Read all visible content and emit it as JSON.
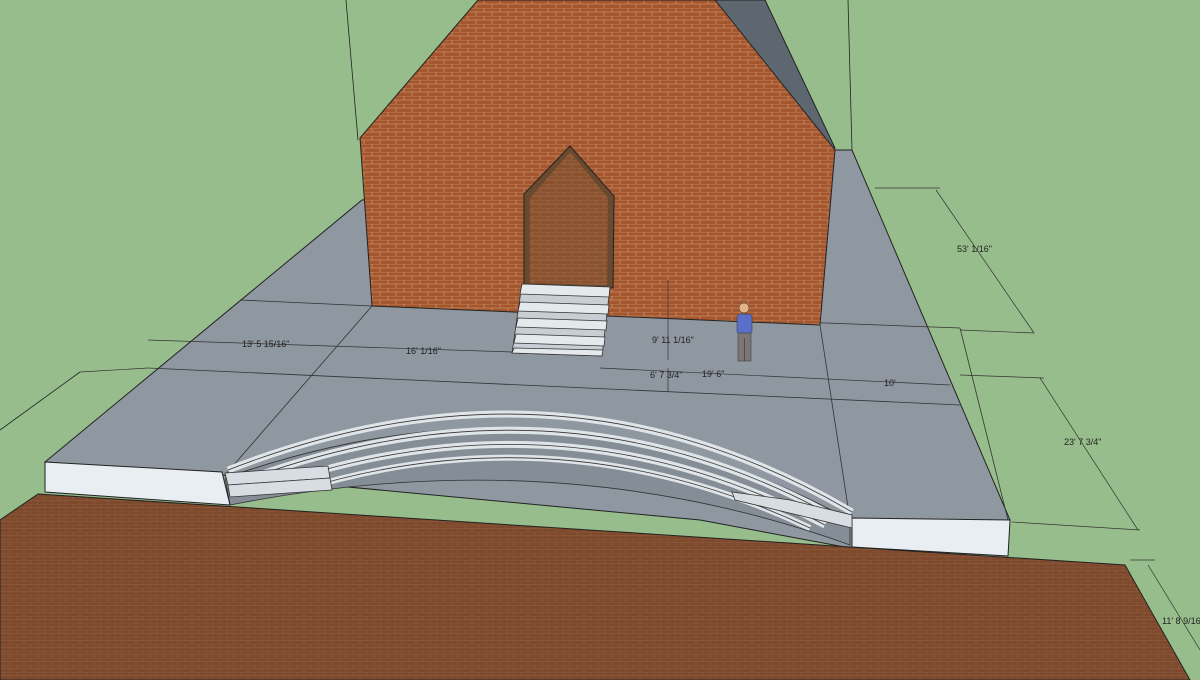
{
  "colors": {
    "ground": "#97bd8c",
    "plaza_top": "#8f97a1",
    "plaza_side": "#e8eef2",
    "brick": "#a4562f",
    "brick_mortar": "#c98a62",
    "brick_path": "#7d4a2e",
    "roof": "#5e6670",
    "step_light": "#d7dde2",
    "person_shirt": "#5a6fc9",
    "person_pants": "#7c7774"
  },
  "icons": [
    "person-figure-icon"
  ],
  "dimensions": [
    {
      "id": "church-depth",
      "label": "53' 1/16\""
    },
    {
      "id": "left-slab",
      "label": "13' 5 15/16\""
    },
    {
      "id": "center-slab",
      "label": "16' 1/16\""
    },
    {
      "id": "stair-height",
      "label": "9' 11 1/16\""
    },
    {
      "id": "step-offset",
      "label": "6' 7 3/4\""
    },
    {
      "id": "right-center",
      "label": "19' 6\""
    },
    {
      "id": "right-slab",
      "label": "10'"
    },
    {
      "id": "plaza-depth",
      "label": "23' 7 3/4\""
    },
    {
      "id": "path-width",
      "label": "11' 8 9/16\""
    }
  ]
}
